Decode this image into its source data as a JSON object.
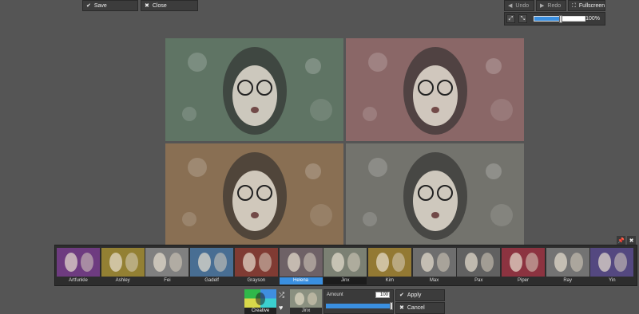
{
  "toolbar": {
    "save_label": "Save",
    "close_label": "Close",
    "undo_label": "Undo",
    "redo_label": "Redo",
    "fullscreen_label": "Fullscreen",
    "zoom_value": "100%",
    "zoom_fraction": 0.5
  },
  "preview": {
    "tiles": [
      {
        "tint": "#7f9b86"
      },
      {
        "tint": "#b98a8a"
      },
      {
        "tint": "#b7946f"
      },
      {
        "tint": "#9a9a92"
      }
    ]
  },
  "filters": [
    {
      "label": "Artfunkle",
      "color": "#8a4aa0"
    },
    {
      "label": "Ashley",
      "color": "#b8a040"
    },
    {
      "label": "Fei",
      "color": "#a0a0a0"
    },
    {
      "label": "Gadelf",
      "color": "#5a8ab8"
    },
    {
      "label": "Grayson",
      "color": "#a04a40"
    },
    {
      "label": "Helena",
      "color": "#8a7a80"
    },
    {
      "label": "Jinx",
      "color": "#9aa090"
    },
    {
      "label": "Kim",
      "color": "#b89840"
    },
    {
      "label": "Max",
      "color": "#8a8a8a"
    },
    {
      "label": "Pax",
      "color": "#7a7a7a"
    },
    {
      "label": "Piper",
      "color": "#b04050"
    },
    {
      "label": "Ray",
      "color": "#909090"
    },
    {
      "label": "Yin",
      "color": "#6a5aa0"
    }
  ],
  "selected_filter": "Helena",
  "category": {
    "label": "Creative"
  },
  "current": {
    "label": "Jinx"
  },
  "amount": {
    "label": "Amount",
    "value": "100",
    "fraction": 1.0
  },
  "actions": {
    "apply_label": "Apply",
    "cancel_label": "Cancel"
  },
  "icons": {
    "check": "check-icon",
    "close": "close-icon",
    "undo": "undo-icon",
    "redo": "redo-icon",
    "fullscreen": "fullscreen-icon",
    "pin": "pin-icon",
    "shuffle": "shuffle-icon",
    "heart": "heart-icon"
  }
}
